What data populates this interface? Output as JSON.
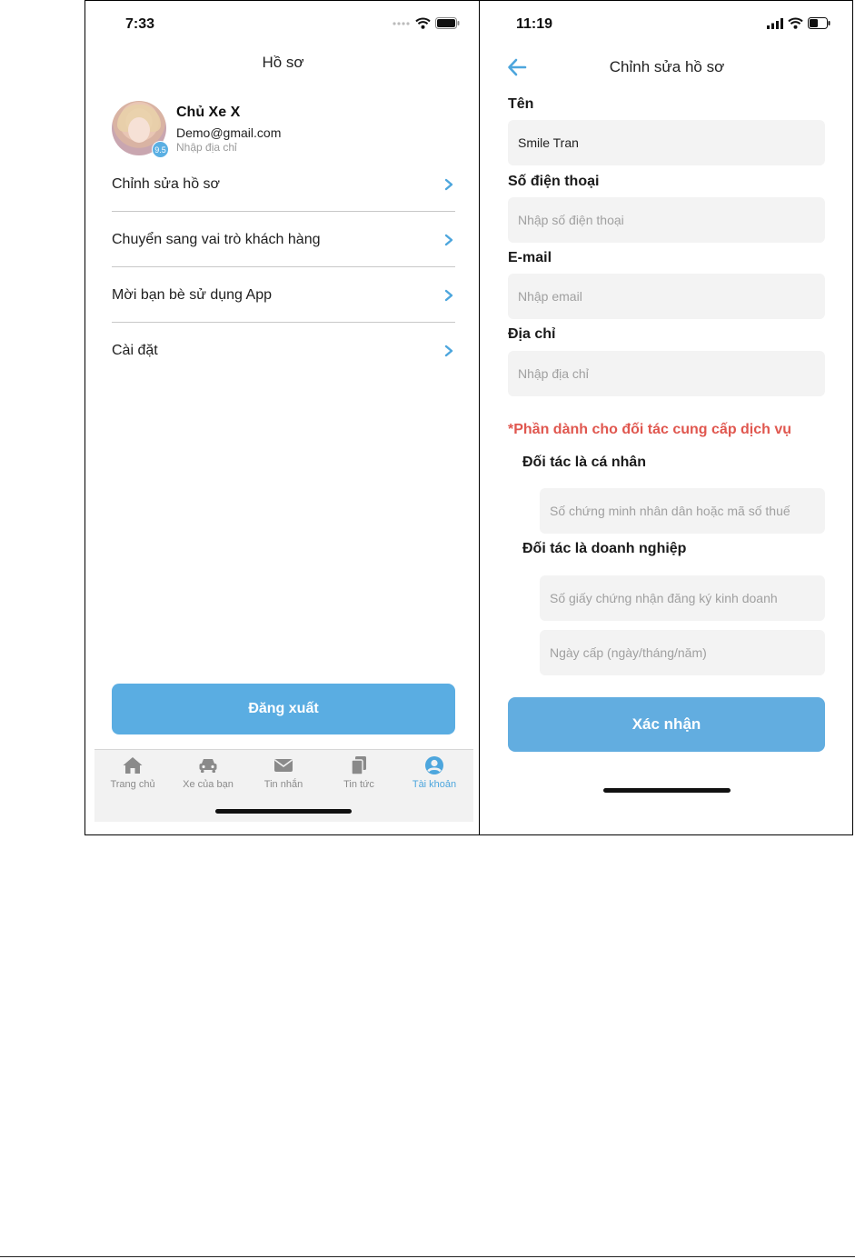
{
  "colors": {
    "accent": "#5aade2",
    "tab_active": "#4da6dd",
    "partner_note": "#e0574f",
    "field_bg": "#f3f3f3"
  },
  "left_screen": {
    "status_time": "7:33",
    "title": "Hồ sơ",
    "profile": {
      "name": "Chủ Xe X",
      "email": "Demo@gmail.com",
      "address": "Nhập địa chỉ",
      "rating": "9.5"
    },
    "menu": [
      {
        "label": "Chỉnh sửa hồ sơ",
        "icon": "chevron-right-icon"
      },
      {
        "label": "Chuyển sang vai trò khách hàng",
        "icon": "chevron-right-icon"
      },
      {
        "label": "Mời bạn bè sử dụng App",
        "icon": "chevron-right-icon"
      },
      {
        "label": "Cài đặt",
        "icon": "chevron-right-icon"
      }
    ],
    "logout_label": "Đăng xuất",
    "tabs": [
      {
        "label": "Trang chủ",
        "icon": "home-icon"
      },
      {
        "label": "Xe của bạn",
        "icon": "car-icon"
      },
      {
        "label": "Tin nhắn",
        "icon": "mail-icon"
      },
      {
        "label": "Tin tức",
        "icon": "documents-icon"
      },
      {
        "label": "Tài khoản",
        "icon": "account-icon",
        "active": true
      }
    ]
  },
  "right_screen": {
    "status_time": "11:19",
    "title": "Chỉnh sửa hồ sơ",
    "fields": {
      "name": {
        "label": "Tên",
        "value": "Smile Tran"
      },
      "phone": {
        "label": "Số điện thoại",
        "placeholder": "Nhập số điện thoại"
      },
      "email": {
        "label": "E-mail",
        "placeholder": "Nhập email"
      },
      "address": {
        "label": "Địa chỉ",
        "placeholder": "Nhập địa chỉ"
      }
    },
    "partner_note": "*Phần dành cho đối tác cung cấp dịch vụ",
    "individual": {
      "label": "Đối tác là cá nhân",
      "id_placeholder": "Số chứng minh nhân dân hoặc mã số thuế"
    },
    "business": {
      "label": "Đối tác là doanh nghiệp",
      "license_placeholder": "Số giấy chứng nhận đăng ký kinh doanh",
      "date_placeholder": "Ngày cấp (ngày/tháng/năm)"
    },
    "confirm_label": "Xác nhận"
  }
}
